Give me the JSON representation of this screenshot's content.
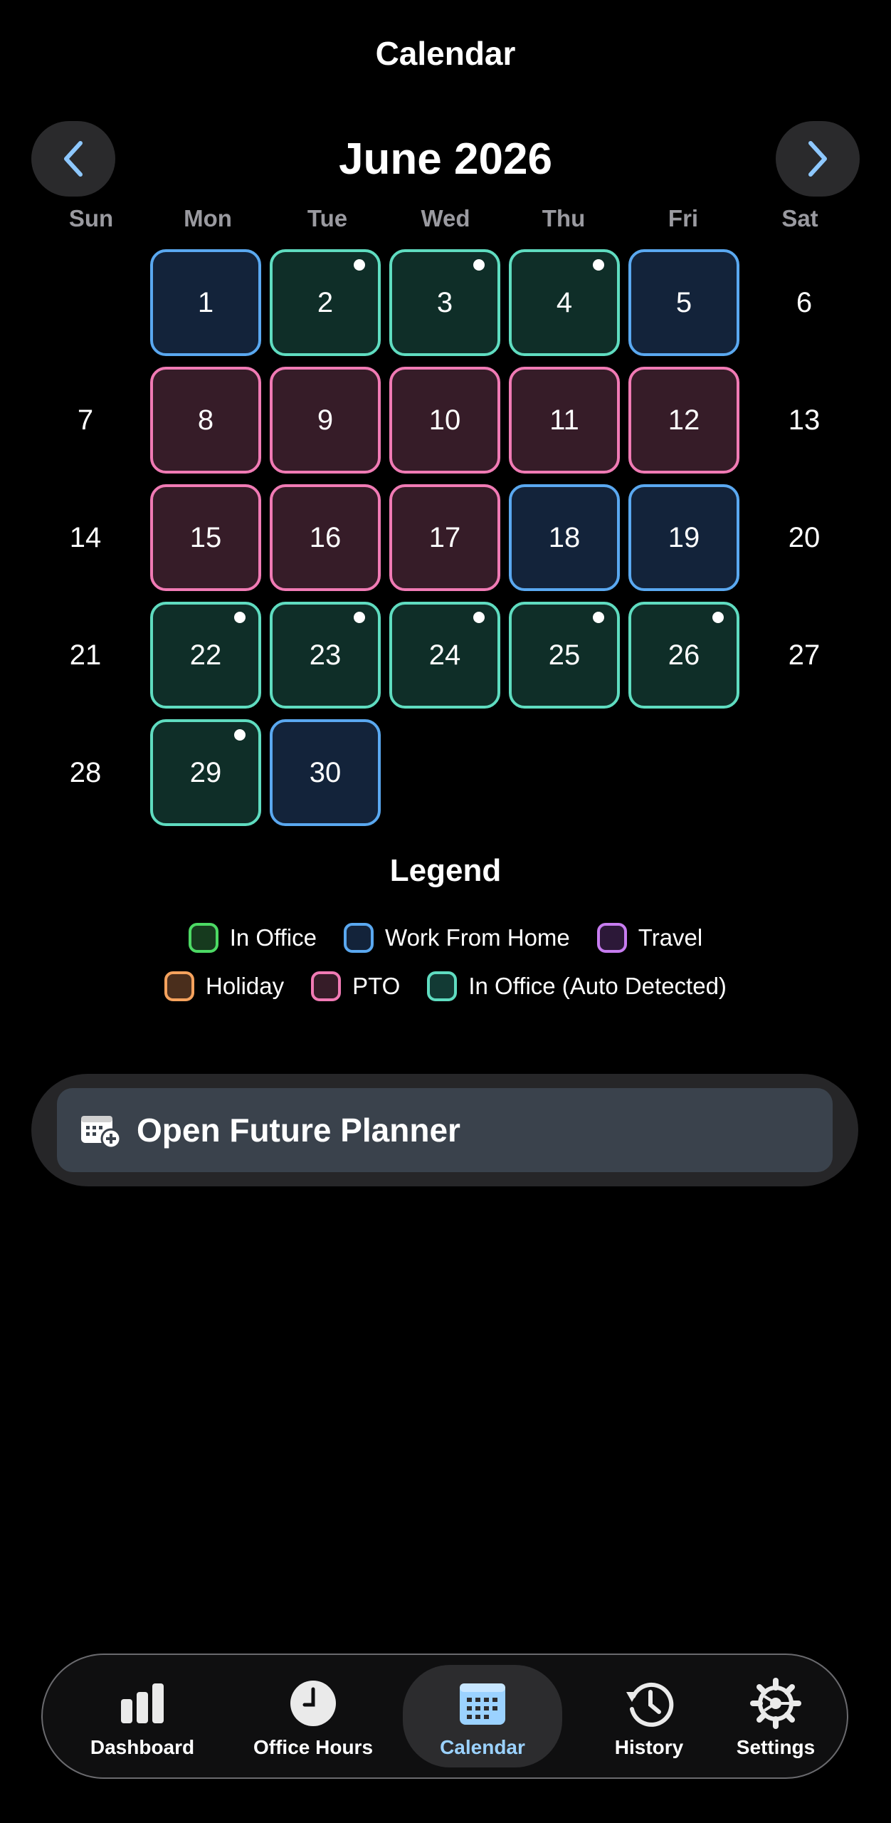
{
  "header": {
    "title": "Calendar"
  },
  "calendar": {
    "month_label": "June 2026",
    "prev_icon": "chevron-left-icon",
    "next_icon": "chevron-right-icon",
    "weekdays": [
      "Sun",
      "Mon",
      "Tue",
      "Wed",
      "Thu",
      "Fri",
      "Sat"
    ],
    "days": [
      {
        "label": "1",
        "status": "wfh",
        "dot": false
      },
      {
        "label": "2",
        "status": "auto",
        "dot": true
      },
      {
        "label": "3",
        "status": "auto",
        "dot": true
      },
      {
        "label": "4",
        "status": "auto",
        "dot": true
      },
      {
        "label": "5",
        "status": "wfh",
        "dot": false
      },
      {
        "label": "6",
        "status": "none",
        "dot": false
      },
      {
        "label": "7",
        "status": "none",
        "dot": false
      },
      {
        "label": "8",
        "status": "pto",
        "dot": false
      },
      {
        "label": "9",
        "status": "pto",
        "dot": false
      },
      {
        "label": "10",
        "status": "pto",
        "dot": false
      },
      {
        "label": "11",
        "status": "pto",
        "dot": false
      },
      {
        "label": "12",
        "status": "pto",
        "dot": false
      },
      {
        "label": "13",
        "status": "none",
        "dot": false
      },
      {
        "label": "14",
        "status": "none",
        "dot": false
      },
      {
        "label": "15",
        "status": "pto",
        "dot": false
      },
      {
        "label": "16",
        "status": "pto",
        "dot": false
      },
      {
        "label": "17",
        "status": "pto",
        "dot": false
      },
      {
        "label": "18",
        "status": "wfh",
        "dot": false
      },
      {
        "label": "19",
        "status": "wfh",
        "dot": false
      },
      {
        "label": "20",
        "status": "none",
        "dot": false
      },
      {
        "label": "21",
        "status": "none",
        "dot": false
      },
      {
        "label": "22",
        "status": "auto",
        "dot": true
      },
      {
        "label": "23",
        "status": "auto",
        "dot": true
      },
      {
        "label": "24",
        "status": "auto",
        "dot": true
      },
      {
        "label": "25",
        "status": "auto",
        "dot": true
      },
      {
        "label": "26",
        "status": "auto",
        "dot": true
      },
      {
        "label": "27",
        "status": "none",
        "dot": false
      },
      {
        "label": "28",
        "status": "none",
        "dot": false
      },
      {
        "label": "29",
        "status": "auto",
        "dot": true
      },
      {
        "label": "30",
        "status": "wfh",
        "dot": false
      }
    ],
    "first_weekday_index": 1
  },
  "legend": {
    "title": "Legend",
    "rows": [
      [
        {
          "label": "In Office",
          "border": "#4cd964",
          "fill": "#163a1e"
        },
        {
          "label": "Work From Home",
          "border": "#5aa8f0",
          "fill": "#13233a"
        },
        {
          "label": "Travel",
          "border": "#c77cf0",
          "fill": "#2c1838"
        }
      ],
      [
        {
          "label": "Holiday",
          "border": "#f5a25d",
          "fill": "#4a2e1c"
        },
        {
          "label": "PTO",
          "border": "#f07ab4",
          "fill": "#361c28"
        },
        {
          "label": "In Office (Auto Detected)",
          "border": "#5fdcc0",
          "fill": "#123a34"
        }
      ]
    ]
  },
  "planner": {
    "label": "Open Future Planner",
    "icon": "calendar-plus-icon"
  },
  "tabbar": {
    "tabs": [
      {
        "label": "Dashboard",
        "icon": "bar-chart-icon",
        "active": false
      },
      {
        "label": "Office Hours",
        "icon": "clock-icon",
        "active": false
      },
      {
        "label": "Calendar",
        "icon": "calendar-icon",
        "active": true
      },
      {
        "label": "History",
        "icon": "history-icon",
        "active": false
      },
      {
        "label": "Settings",
        "icon": "gear-icon",
        "active": false
      }
    ]
  }
}
